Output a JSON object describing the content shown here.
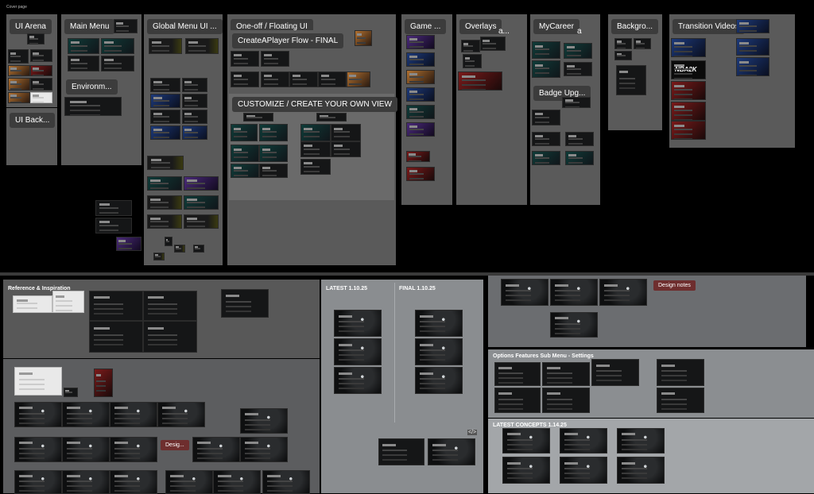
{
  "canvas": {
    "page_label": "Cover page"
  },
  "top_frames": [
    {
      "id": "ui-arena",
      "label": "UI Arena"
    },
    {
      "id": "ui-background",
      "label": "UI Back..."
    },
    {
      "id": "main-menu",
      "label": "Main Menu"
    },
    {
      "id": "environment",
      "label": "Environm..."
    },
    {
      "id": "global-menu",
      "label": "Global Menu UI ..."
    },
    {
      "id": "one-off",
      "label": "One-off / Floating UI"
    },
    {
      "id": "createaplayer",
      "label": "CreateAPlayer Flow - FINAL"
    },
    {
      "id": "customize",
      "label": "CUSTOMIZE / CREATE YOUR OWN VIEW"
    },
    {
      "id": "game",
      "label": "Game ..."
    },
    {
      "id": "overlays",
      "label": "Overlays"
    },
    {
      "id": "overlays-suffix",
      "label": "a..."
    },
    {
      "id": "mycareer",
      "label": "MyCareer"
    },
    {
      "id": "mycareer-suffix",
      "label": "a"
    },
    {
      "id": "badge",
      "label": "Badge Upg..."
    },
    {
      "id": "backgrounds",
      "label": "Backgro..."
    },
    {
      "id": "transition",
      "label": "Transition Videos"
    }
  ],
  "bottom_sections": {
    "reference": "Reference & Inspiration",
    "latest": "LATEST 1.10.25",
    "final": "FINAL 1.10.25",
    "design_notes": "Design notes",
    "options": "Options Features Sub Menu - Settings",
    "concepts": "LATEST CONCEPTS 1.14.25",
    "desig": "Desig..."
  },
  "thumb_text": {
    "nba2k": "NBA2K",
    "code_icon": "</>"
  }
}
